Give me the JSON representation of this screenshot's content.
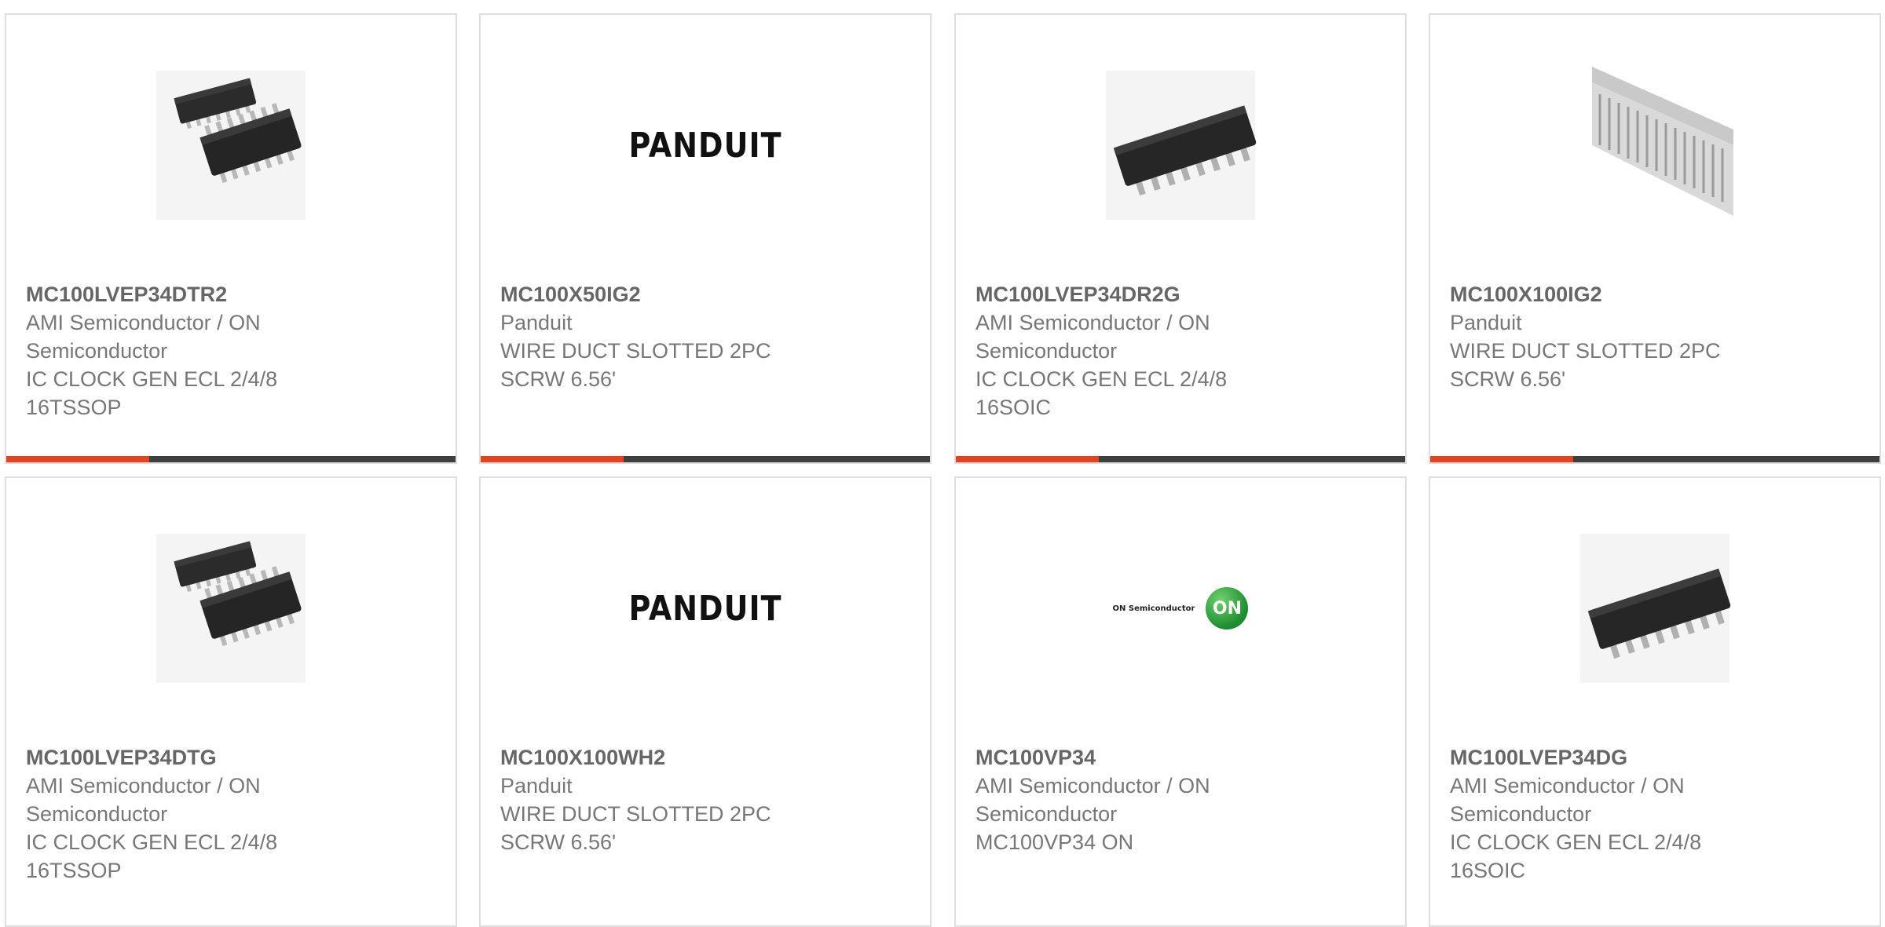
{
  "products": [
    {
      "part_number": "MC100LVEP34DTR2",
      "manufacturer": "AMI Semiconductor / ON Semiconductor",
      "description": "IC CLOCK GEN ECL 2/4/8 16TSSOP",
      "image": "tssop-chip-image"
    },
    {
      "part_number": "MC100X50IG2",
      "manufacturer": "Panduit",
      "description": "WIRE DUCT SLOTTED 2PC SCRW 6.56'",
      "image": "panduit-logo",
      "logo_text": "PANDUIT"
    },
    {
      "part_number": "MC100LVEP34DR2G",
      "manufacturer": "AMI Semiconductor / ON Semiconductor",
      "description": "IC CLOCK GEN ECL 2/4/8 16SOIC",
      "image": "soic-chip-image"
    },
    {
      "part_number": "MC100X100IG2",
      "manufacturer": "Panduit",
      "description": "WIRE DUCT SLOTTED 2PC SCRW 6.56'",
      "image": "wire-duct-image"
    },
    {
      "part_number": "MC100LVEP34DTG",
      "manufacturer": "AMI Semiconductor / ON Semiconductor",
      "description": "IC CLOCK GEN ECL 2/4/8 16TSSOP",
      "image": "tssop-chip-image"
    },
    {
      "part_number": "MC100X100WH2",
      "manufacturer": "Panduit",
      "description": "WIRE DUCT SLOTTED 2PC SCRW 6.56'",
      "image": "panduit-logo",
      "logo_text": "PANDUIT"
    },
    {
      "part_number": "MC100VP34",
      "manufacturer": "AMI Semiconductor / ON Semiconductor",
      "description": "MC100VP34 ON",
      "image": "on-semiconductor-logo",
      "logo_text": "ON Semiconductor",
      "badge_text": "ON"
    },
    {
      "part_number": "MC100LVEP34DG",
      "manufacturer": "AMI Semiconductor / ON Semiconductor",
      "description": "IC CLOCK GEN ECL 2/4/8 16SOIC",
      "image": "soic-chip-image"
    }
  ],
  "colors": {
    "accent": "#e3441f",
    "bar": "#3f3f3f",
    "border": "#dedede",
    "text": "#777777",
    "on_badge": "#1c8c2e"
  }
}
